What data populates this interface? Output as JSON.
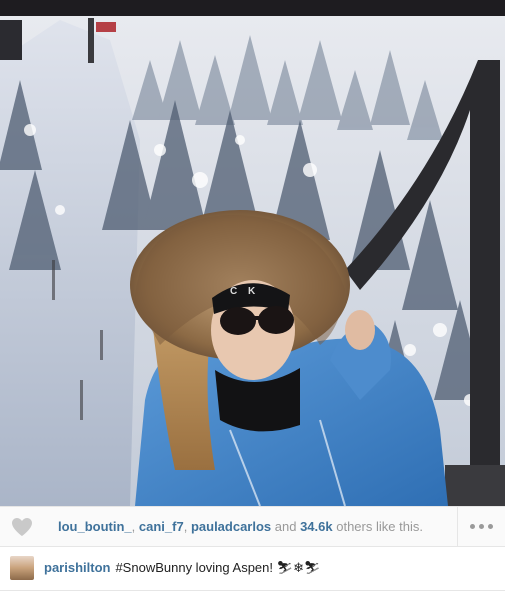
{
  "photo": {
    "alt_subject": "snow-gondola-selfie",
    "hat_text": "C K"
  },
  "likes": {
    "users": [
      "lou_boutin_",
      "cani_f7",
      "pauladcarlos"
    ],
    "sep1": ", ",
    "sep2": ", ",
    "and_text": " and ",
    "count": "34.6k",
    "suffix": " others like this."
  },
  "caption": {
    "username": "parishilton",
    "text": "#SnowBunny loving Aspen! ⛷❄⛷"
  },
  "colors": {
    "link": "#3f729b",
    "muted": "#999999",
    "row_bg": "#fafafa",
    "border": "#e6e6e6"
  },
  "icons": {
    "like": "heart-icon",
    "more": "ellipsis-icon"
  }
}
